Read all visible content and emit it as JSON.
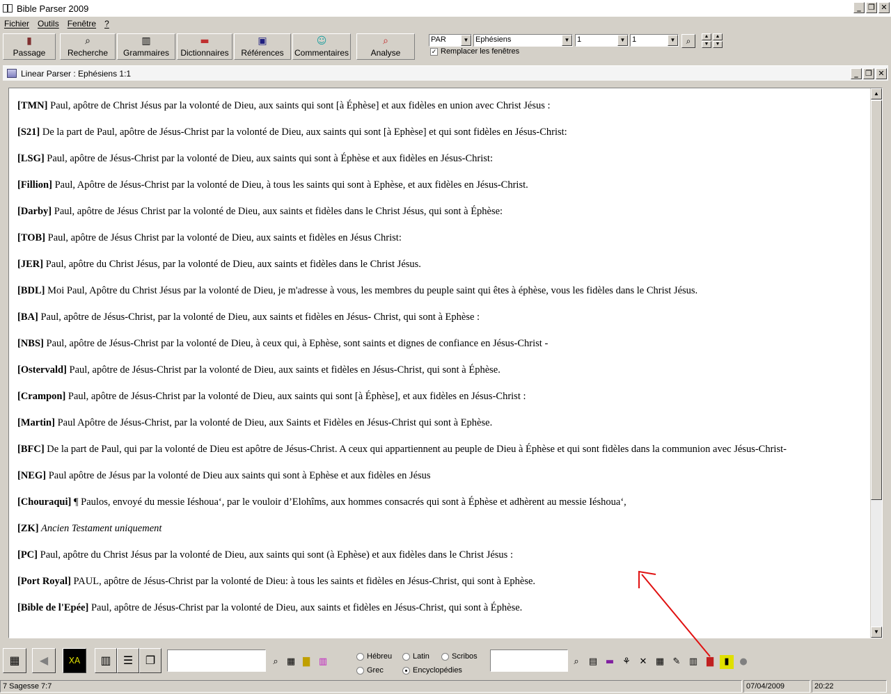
{
  "app": {
    "title": "Bible Parser 2009",
    "win_min": "_",
    "win_restore": "❐",
    "win_close": "✕"
  },
  "menu": {
    "items": [
      "Fichier",
      "Outils",
      "Fenêtre",
      "?"
    ]
  },
  "toolbar": {
    "buttons": [
      "Passage",
      "Recherche",
      "Grammaires",
      "Dictionnaires",
      "Références",
      "Commentaires",
      "Analyse"
    ],
    "version_combo": "PAR",
    "book_combo": "Ephésiens",
    "chapter_combo": "1",
    "verse_combo": "1",
    "replace_windows_label": "Remplacer les fenêtres",
    "replace_windows_checked": true
  },
  "child_window": {
    "title": "Linear Parser : Ephésiens 1:1"
  },
  "verses": [
    {
      "code": "[TMN]",
      "text": " Paul, apôtre de Christ Jésus par la volonté de Dieu, aux saints qui sont [à Éphèse] et aux fidèles en union avec Christ Jésus :"
    },
    {
      "code": "[S21]",
      "text": " De la part de Paul, apôtre de Jésus-Christ par la volonté de Dieu, aux saints qui sont [à Ephèse] et qui sont fidèles en Jésus-Christ:"
    },
    {
      "code": "[LSG]",
      "text": " Paul, apôtre de Jésus-Christ par la volonté de Dieu, aux saints qui sont à Éphèse et aux fidèles en Jésus-Christ:"
    },
    {
      "code": "[Fillion]",
      "text": " Paul, Apôtre de Jésus-Christ par la volonté de Dieu, à tous les saints qui sont à Ephèse, et aux fidèles en Jésus-Christ."
    },
    {
      "code": "[Darby]",
      "text": " Paul, apôtre de Jésus Christ par la volonté de Dieu, aux saints et fidèles dans le Christ Jésus, qui sont à Éphèse:"
    },
    {
      "code": "[TOB]",
      "text": " Paul, apôtre de Jésus Christ par la volonté de Dieu, aux saints et fidèles en Jésus Christ:"
    },
    {
      "code": "[JER]",
      "text": " Paul, apôtre du Christ Jésus, par la volonté de Dieu, aux saints et fidèles dans le Christ Jésus."
    },
    {
      "code": "[BDL]",
      "text": " Moi Paul, Apôtre du Christ Jésus par la volonté de Dieu, je m'adresse à vous, les membres du peuple saint qui êtes à éphèse, vous les fidèles dans le Christ Jésus."
    },
    {
      "code": "[BA]",
      "text": " Paul, apôtre de Jésus-Christ, par la volonté de Dieu, aux saints et fidèles en Jésus- Christ, qui sont à Ephèse :"
    },
    {
      "code": "[NBS]",
      "text": " Paul, apôtre de Jésus-Christ par la volonté de Dieu, à ceux qui, à Ephèse, sont saints et dignes de confiance en Jésus-Christ -"
    },
    {
      "code": "[Ostervald]",
      "text": " Paul, apôtre de Jésus-Christ par la volonté de Dieu, aux saints et fidèles en Jésus-Christ, qui sont à Éphèse."
    },
    {
      "code": "[Crampon]",
      "text": " Paul, apôtre de Jésus-Christ par la volonté de Dieu, aux saints qui sont [à Éphèse], et aux fidèles en Jésus-Christ :"
    },
    {
      "code": "[Martin]",
      "text": " Paul Apôtre de Jésus-Christ, par la volonté de Dieu, aux Saints et Fidèles en Jésus-Christ qui sont à Ephèse."
    },
    {
      "code": "[BFC]",
      "text": " De la part de Paul, qui par la volonté de Dieu est apôtre de Jésus-Christ. A ceux qui appartiennent au peuple de Dieu à Éphèse et qui sont fidèles dans la communion avec Jésus-Christ-"
    },
    {
      "code": "[NEG]",
      "text": " Paul apôtre de Jésus par la volonté de Dieu aux saints qui sont à Ephèse et aux fidèles en Jésus"
    },
    {
      "code": "[Chouraqui]",
      "text": " ¶ Paulos, envoyé du messie Iéshoua‘, par le vouloir d’Elohîms, aux hommes consacrés qui sont à Éphèse et adhèrent au messie Iéshoua‘,"
    },
    {
      "code": "[ZK]",
      "text": " Ancien Testament uniquement",
      "italic": true
    },
    {
      "code": "[PC]",
      "text": " Paul, apôtre du Christ Jésus par la volonté de Dieu, aux saints qui sont (à Ephèse) et aux fidèles dans le Christ Jésus :"
    },
    {
      "code": "[Port Royal]",
      "text": "  PAUL, apôtre de Jésus-Christ par la volonté de Dieu: à tous les saints et fidèles en Jésus-Christ, qui sont à Ephèse."
    },
    {
      "code": "[Bible de l'Epée]",
      "text": " Paul, apôtre de Jésus-Christ par la volonté de Dieu, aux saints et fidèles en Jésus-Christ, qui sont à Éphèse."
    }
  ],
  "bottom": {
    "radios": [
      {
        "label": "Hébreu",
        "checked": false
      },
      {
        "label": "Latin",
        "checked": false
      },
      {
        "label": "Scribos",
        "checked": false
      },
      {
        "label": "Grec",
        "checked": false
      },
      {
        "label": "Encyclopédies",
        "checked": true
      }
    ]
  },
  "status": {
    "left": "7 Sagesse 7:7",
    "date": "07/04/2009",
    "time": "20:22"
  },
  "colors": {
    "annotation_arrow": "#e01010",
    "window_bg": "#d4d0c8"
  }
}
